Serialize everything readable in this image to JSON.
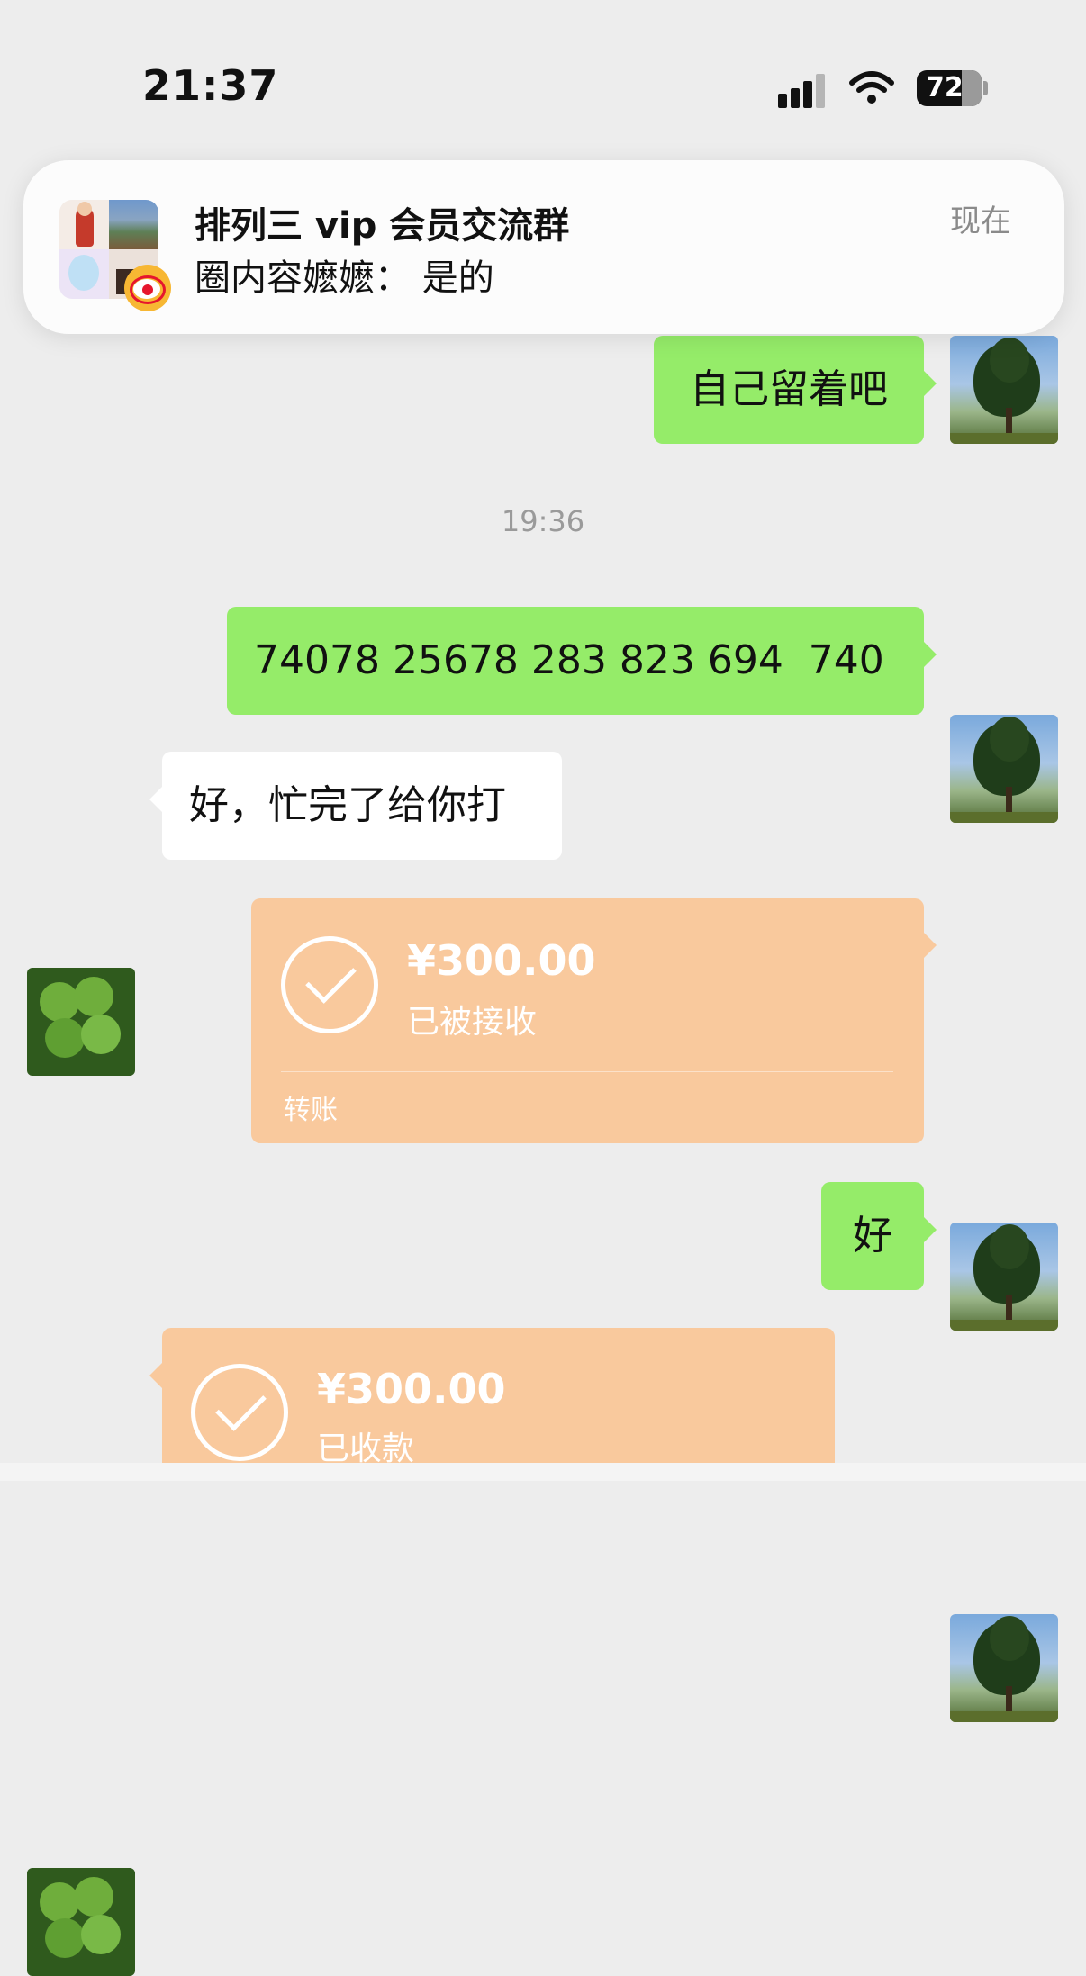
{
  "status_bar": {
    "time": "21:37",
    "battery": "72"
  },
  "notification": {
    "title": "排列三 vip 会员交流群",
    "message": "圈内容嬷嬷： 是的",
    "time": "现在",
    "app_icon": "weibo-icon"
  },
  "messages": [
    {
      "side": "right",
      "type": "text",
      "text": "自己留着吧"
    },
    {
      "type": "timestamp",
      "text": "19:36"
    },
    {
      "side": "right",
      "type": "text",
      "text": "74078 25678 283 823 694  740"
    },
    {
      "side": "left",
      "type": "text",
      "text": "好，忙完了给你打"
    },
    {
      "side": "right",
      "type": "transfer",
      "amount": "¥300.00",
      "status": "已被接收",
      "label": "转账"
    },
    {
      "side": "right",
      "type": "text",
      "text": "好"
    },
    {
      "side": "left",
      "type": "transfer",
      "amount": "¥300.00",
      "status": "已收款"
    }
  ],
  "colors": {
    "background": "#ededed",
    "sent_bubble": "#95ec69",
    "received_bubble": "#ffffff",
    "transfer_card": "#f9c99d"
  }
}
